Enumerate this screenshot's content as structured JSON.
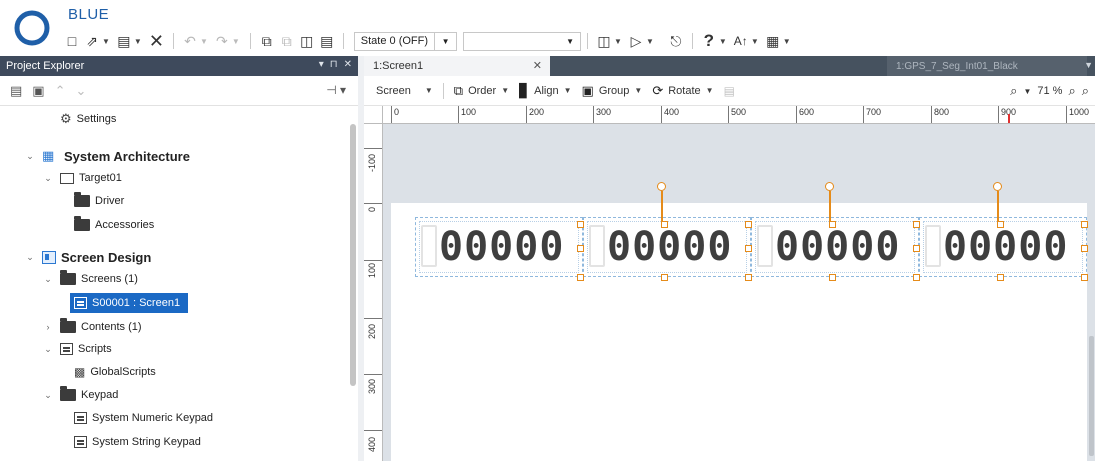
{
  "app": {
    "title": "BLUE"
  },
  "toolbar": {
    "icons": [
      "new-file-icon",
      "open-folder-icon",
      "save-icon",
      "close-x-icon",
      "undo-icon",
      "redo-icon",
      "copy-icon",
      "cut-icon",
      "paste-icon",
      "delete-icon",
      "layout-icon",
      "play-icon",
      "simulate-icon",
      "help-icon",
      "font-size-icon",
      "table-icon"
    ],
    "state_label": "State 0 (OFF)",
    "blank_select": ""
  },
  "explorer": {
    "title": "Project Explorer",
    "header_controls": [
      "▾",
      "⊓",
      "✕"
    ],
    "tree": {
      "settings": "Settings",
      "system_architecture": "System Architecture",
      "target01": "Target01",
      "driver": "Driver",
      "accessories": "Accessories",
      "screen_design": "Screen Design",
      "screens": "Screens (1)",
      "screen1": "S00001 : Screen1",
      "contents": "Contents (1)",
      "scripts": "Scripts",
      "global_scripts": "GlobalScripts",
      "keypad": "Keypad",
      "numeric_keypad": "System Numeric Keypad",
      "string_keypad": "System String Keypad"
    }
  },
  "editor": {
    "tabs": {
      "active": "1:Screen1",
      "inactive": "1:GPS_7_Seg_Int01_Black"
    },
    "design_toolbar": {
      "screen": "Screen",
      "order": "Order",
      "align": "Align",
      "group": "Group",
      "rotate": "Rotate",
      "zoom": "71 %"
    },
    "ruler": {
      "h_labels": [
        "0",
        "100",
        "200",
        "300",
        "400",
        "500",
        "600",
        "700",
        "800",
        "900",
        "1000"
      ],
      "v_labels": [
        "-100",
        "0",
        "100",
        "200",
        "300",
        "400"
      ]
    },
    "displays": [
      {
        "value": "00000"
      },
      {
        "value": "00000"
      },
      {
        "value": "00000"
      },
      {
        "value": "00000"
      }
    ]
  },
  "colors": {
    "accent": "#1b69c4",
    "header_dark": "#3e4a5c",
    "handle_orange": "#e58b1a",
    "canvas_bg": "#dce1e7"
  }
}
